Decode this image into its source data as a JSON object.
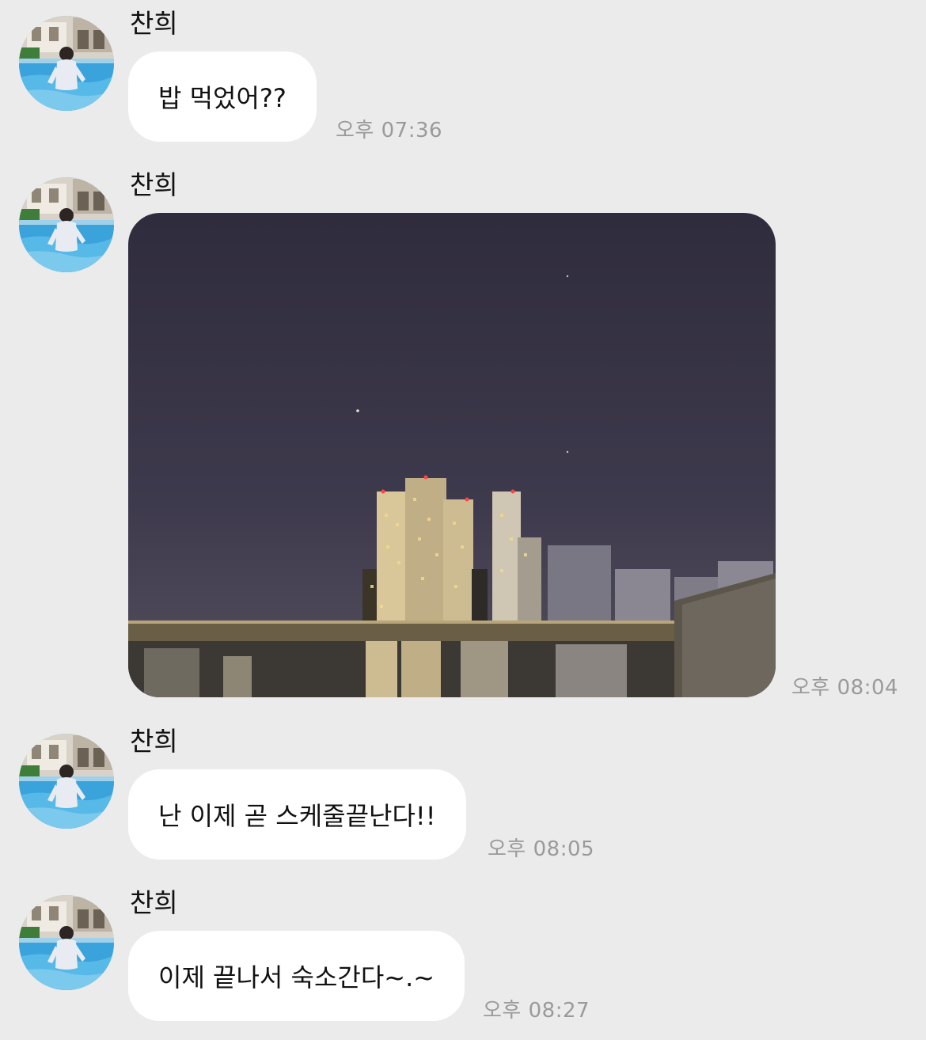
{
  "messages": [
    {
      "sender": "찬희",
      "text": "밥 먹었어??",
      "time": "오후 07:36"
    },
    {
      "sender": "찬희",
      "type": "image",
      "image_icon": "night-city-photo",
      "time": "오후 08:04"
    },
    {
      "sender": "찬희",
      "text": "난 이제 곧 스케줄끝난다!!",
      "time": "오후 08:05"
    },
    {
      "sender": "찬희",
      "text": "이제 끝나서 숙소간다~.~",
      "time": "오후 08:27"
    }
  ],
  "avatar_icon": "profile-photo-pool",
  "colors": {
    "background": "#ebebeb",
    "bubble": "#ffffff",
    "time": "#9a9a9a"
  }
}
